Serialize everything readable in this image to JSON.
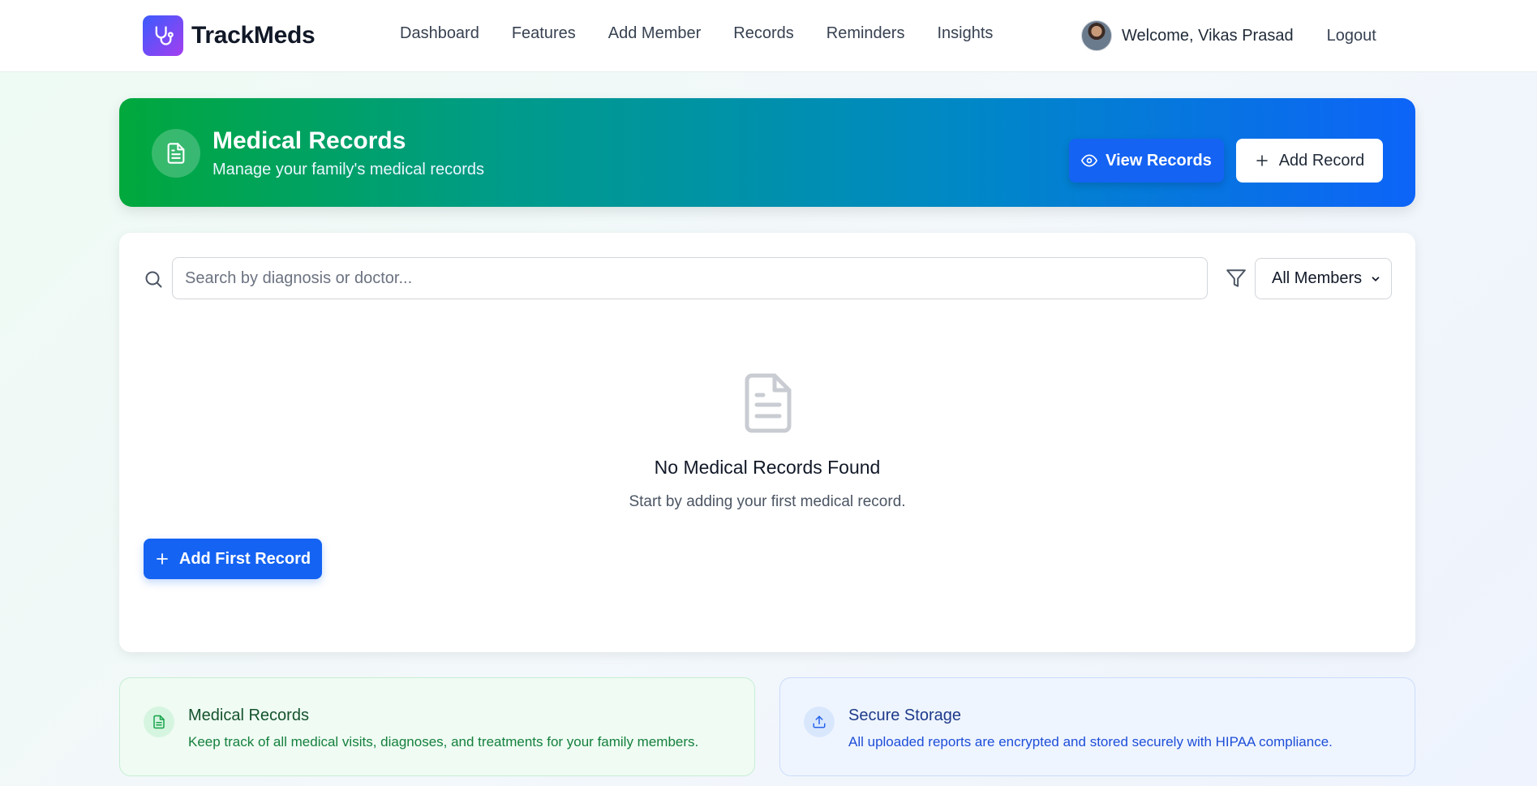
{
  "nav": {
    "brand": "TrackMeds",
    "links": [
      "Dashboard",
      "Features",
      "Add Member",
      "Records",
      "Reminders",
      "Insights"
    ],
    "welcome": "Welcome, Vikas Prasad",
    "logout": "Logout",
    "brand_icon": "stethoscope-icon"
  },
  "hero": {
    "title": "Medical Records",
    "subtitle": "Manage your family's medical records",
    "view_label": "View Records",
    "add_label": "Add Record",
    "icon": "document-icon"
  },
  "search": {
    "placeholder": "Search by diagnosis or doctor...",
    "value": "",
    "member_filter": "All Members"
  },
  "empty": {
    "title": "No Medical Records Found",
    "subtitle": "Start by adding your first medical record.",
    "button": "Add First Record"
  },
  "info_cards": [
    {
      "title": "Medical Records",
      "text": "Keep track of all medical visits, diagnoses, and treatments for your family members.",
      "icon": "document-icon"
    },
    {
      "title": "Secure Storage",
      "text": "All uploaded reports are encrypted and stored securely with HIPAA compliance.",
      "icon": "upload-icon"
    }
  ],
  "colors": {
    "primary": "#1463f3",
    "hero_start": "#00a83c",
    "hero_end": "#0d64f8",
    "brand_start": "#3b5bfd",
    "brand_end": "#a43ef0"
  }
}
